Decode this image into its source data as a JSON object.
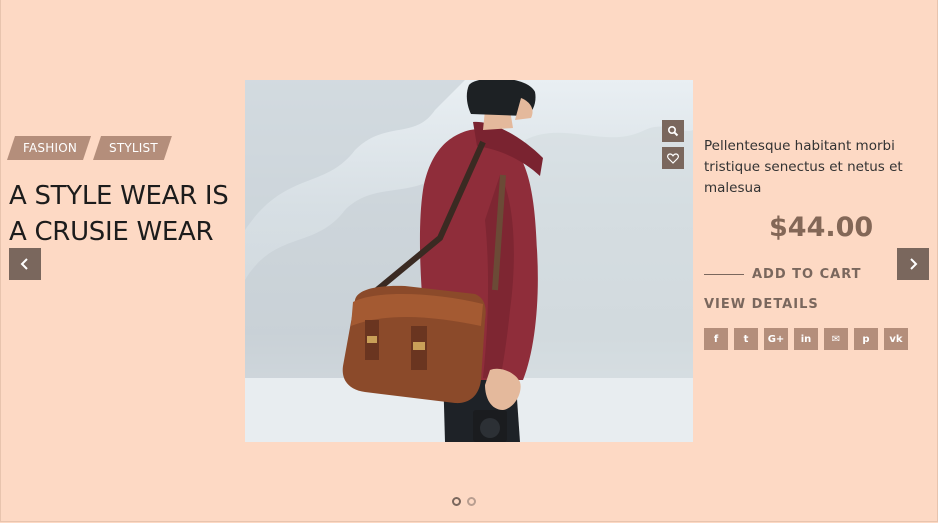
{
  "tags": [
    "FASHION",
    "STYLIST"
  ],
  "headline": [
    "A STYLE WEAR IS",
    "A CRUSIE WEAR"
  ],
  "product": {
    "description": "Pellentesque habitant morbi tristique senectus et netus et malesua",
    "price": "$44.00",
    "add_to_cart": "ADD TO CART",
    "view_details": "VIEW DETAILS"
  },
  "socials": [
    {
      "name": "facebook-icon",
      "glyph": "f"
    },
    {
      "name": "twitter-icon",
      "glyph": "t"
    },
    {
      "name": "google-plus-icon",
      "glyph": "G+"
    },
    {
      "name": "linkedin-icon",
      "glyph": "in"
    },
    {
      "name": "mail-icon",
      "glyph": "✉"
    },
    {
      "name": "pinterest-icon",
      "glyph": "p"
    },
    {
      "name": "vk-icon",
      "glyph": "vk"
    }
  ],
  "icons": {
    "prev": "chevron-left-icon",
    "next": "chevron-right-icon",
    "quick_search": "search-icon",
    "wishlist": "heart-icon"
  },
  "slider": {
    "total_slides": 2,
    "active_slide": 1
  },
  "colors": {
    "background": "#fdd9c4",
    "accent": "#b48e7b",
    "dark": "#7a675d",
    "price": "#836757"
  }
}
